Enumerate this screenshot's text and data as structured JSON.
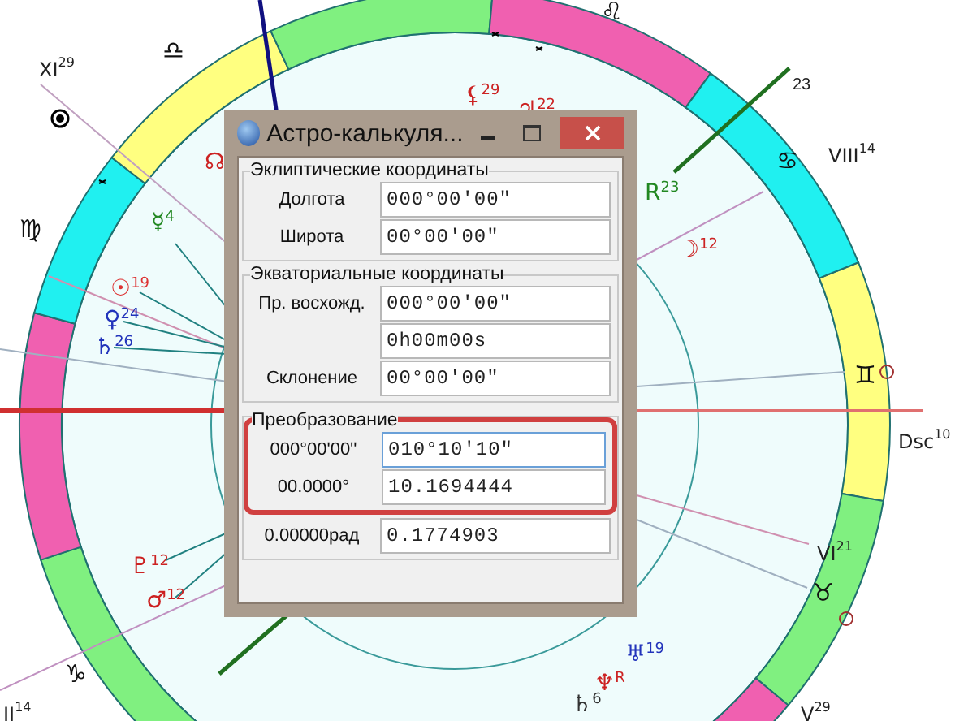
{
  "chart": {
    "signs": [
      {
        "glyph": "♎"
      },
      {
        "glyph": "♌"
      },
      {
        "glyph": "♍"
      },
      {
        "glyph": "♋"
      },
      {
        "glyph": "♊"
      },
      {
        "glyph": "♉"
      },
      {
        "glyph": "♑"
      }
    ],
    "houses": [
      {
        "label": "XI",
        "degree": "29"
      },
      {
        "label": "VIII",
        "degree": "14"
      },
      {
        "label": "Dsc",
        "degree": "10"
      },
      {
        "label": "VI",
        "degree": "21"
      },
      {
        "label": "V",
        "degree": "29"
      },
      {
        "label": "II",
        "degree": "14"
      }
    ],
    "cusp_degree": "23",
    "planets": [
      {
        "glyph": "☊",
        "color": "#cc2222"
      },
      {
        "glyph": "☿",
        "degree": "4",
        "color": "#228822"
      },
      {
        "glyph": "☉",
        "degree": "19",
        "color": "#dd3333"
      },
      {
        "glyph": "♀",
        "degree": "24",
        "color": "#2233bb"
      },
      {
        "glyph": "♄",
        "degree": "26",
        "color": "#2233bb"
      },
      {
        "glyph": "⚸",
        "degree": "29",
        "color": "#cc2222"
      },
      {
        "glyph": "♃",
        "degree": "22",
        "color": "#cc2222"
      },
      {
        "glyph": "R",
        "degree": "23",
        "color": "#228822"
      },
      {
        "glyph": "☽",
        "degree": "12",
        "color": "#cc2222"
      },
      {
        "glyph": "♇",
        "degree": "12",
        "color": "#cc2222"
      },
      {
        "glyph": "♂",
        "degree": "12",
        "color": "#cc2222"
      },
      {
        "glyph": "♅",
        "degree": "19",
        "color": "#2233bb"
      },
      {
        "glyph": "♆",
        "degree": "R",
        "color": "#cc2222"
      },
      {
        "glyph": "♄",
        "degree": "6",
        "color": "#333333"
      }
    ]
  },
  "dialog": {
    "title": "Астро-калькуля...",
    "groups": [
      {
        "title": "Эклиптические координаты",
        "highlighted": false,
        "rows": [
          {
            "label": "Долгота",
            "value": "000°00'00\"",
            "focused": false
          },
          {
            "label": "Широта",
            "value": "00°00'00\"",
            "focused": false
          }
        ]
      },
      {
        "title": "Экваториальные координаты",
        "highlighted": false,
        "rows": [
          {
            "label": "Пр. восхожд.",
            "value": "000°00'00\"",
            "focused": false
          },
          {
            "value": "0h00m00s",
            "focused": false
          },
          {
            "label": "Склонение",
            "value": "00°00'00\"",
            "focused": false
          }
        ]
      },
      {
        "title": "Преобразование",
        "highlighted": true,
        "rows": [
          {
            "label": "000°00'00''",
            "value": "010°10'10\"",
            "focused": true
          },
          {
            "label": "00.0000°",
            "value": "10.1694444",
            "focused": false
          }
        ],
        "extra_rows": [
          {
            "label": "0.00000рад",
            "value": "0.1774903",
            "focused": false
          }
        ]
      }
    ]
  }
}
